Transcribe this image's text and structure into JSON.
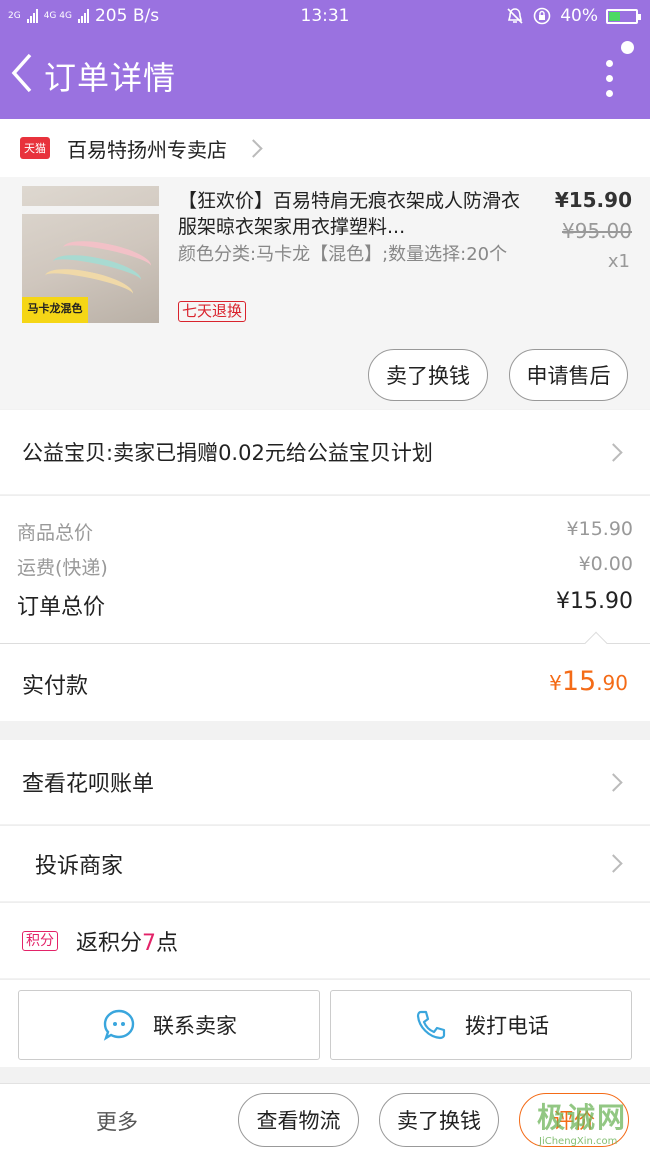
{
  "status_bar": {
    "sim1": "2G",
    "sim2": "4G 4G",
    "speed": "205 B/s",
    "time": "13:31",
    "battery": "40%",
    "battery_level": 0.4
  },
  "nav": {
    "title": "订单详情"
  },
  "store": {
    "badge": "天猫",
    "name": "百易特扬州专卖店"
  },
  "product": {
    "title": "【狂欢价】百易特肩无痕衣架成人防滑衣服架晾衣架家用衣撑塑料...",
    "spec": "颜色分类:马卡龙【混色】;数量选择:20个",
    "image_label": "马卡龙混色",
    "return_badge": "七天退换",
    "price": "¥15.90",
    "original_price": "¥95.00",
    "quantity": "x1",
    "btn_sell": "卖了换钱",
    "btn_after_sale": "申请售后"
  },
  "charity": {
    "text": "公益宝贝:卖家已捐赠0.02元给公益宝贝计划"
  },
  "summary": {
    "goods_label": "商品总价",
    "goods_value": "¥15.90",
    "shipping_label": "运费(快递)",
    "shipping_value": "¥0.00",
    "total_label": "订单总价",
    "total_value": "¥15.90"
  },
  "paid": {
    "label": "实付款",
    "currency": "¥",
    "int_part": "15",
    "dec_part": ".90"
  },
  "huabei": {
    "text": "查看花呗账单"
  },
  "complain": {
    "text": "投诉商家"
  },
  "points": {
    "badge": "积分",
    "prefix": "返积分",
    "number": "7",
    "suffix": "点"
  },
  "contact": {
    "seller": "联系卖家",
    "phone": "拨打电话"
  },
  "bottom": {
    "more": "更多",
    "logistics": "查看物流",
    "sell": "卖了换钱",
    "rate": "评价"
  },
  "watermark": {
    "text": "极诚网",
    "url": "JiChengXin.com"
  },
  "colors": {
    "header": "#9a72e0",
    "accent_orange": "#f46b17",
    "tmall_red": "#e8323c",
    "points_pink": "#e32368"
  }
}
